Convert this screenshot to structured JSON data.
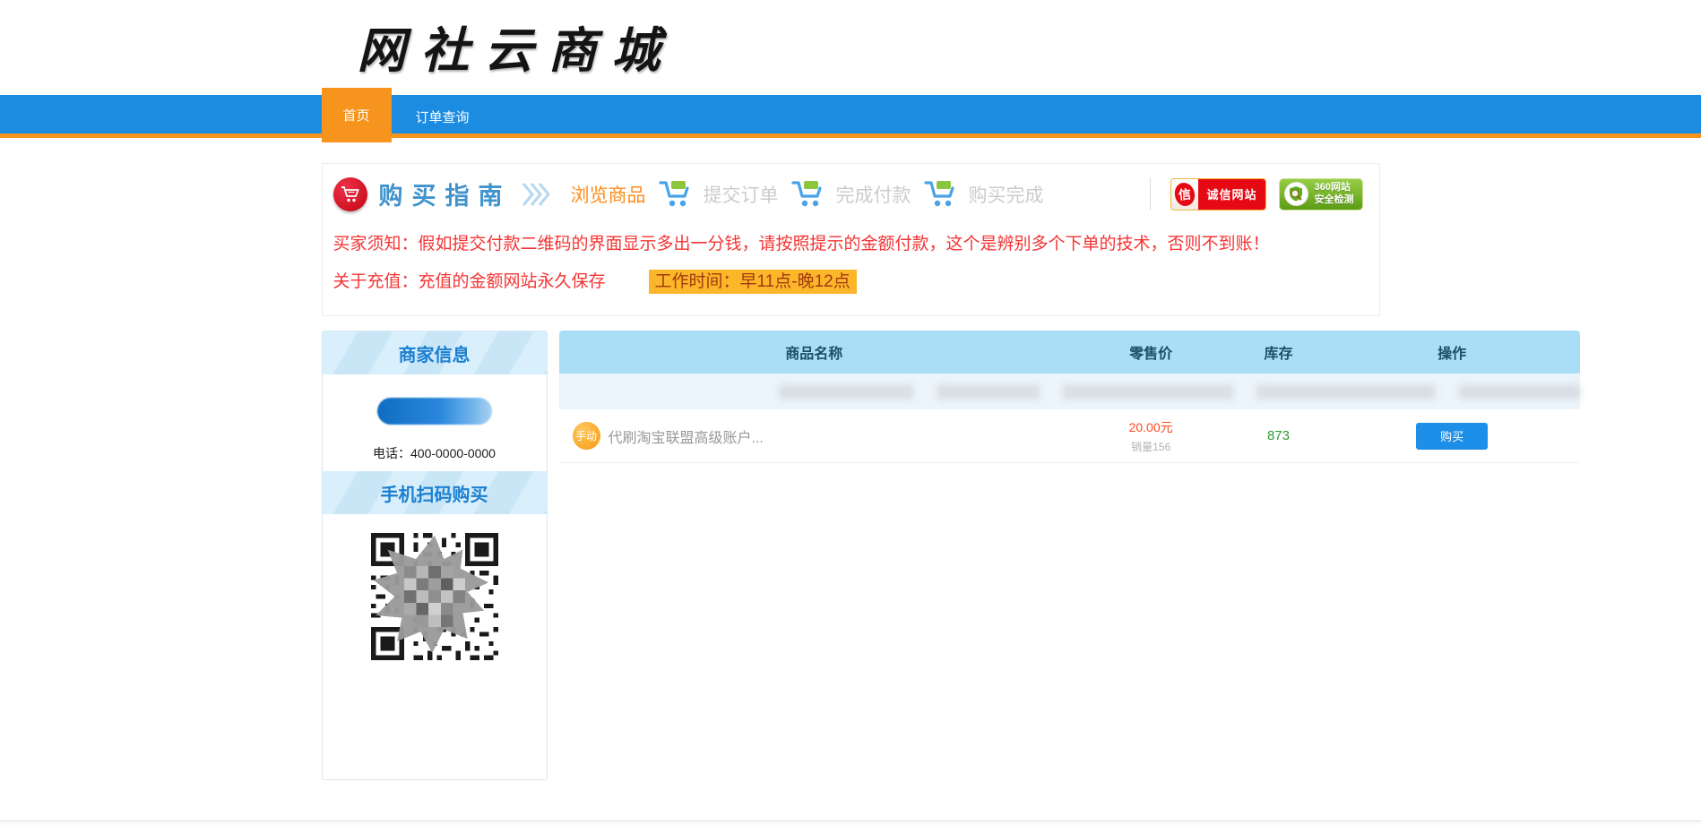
{
  "brand": {
    "logo_text": "网社云商城"
  },
  "nav": {
    "items": [
      {
        "label": "首页",
        "active": true
      },
      {
        "label": "订单查询",
        "active": false
      }
    ]
  },
  "guide": {
    "title": "购买指南",
    "steps": [
      {
        "label": "浏览商品",
        "state": "active"
      },
      {
        "label": "提交订单",
        "state": "inactive"
      },
      {
        "label": "完成付款",
        "state": "inactive"
      },
      {
        "label": "购买完成",
        "state": "inactive"
      }
    ],
    "badges": [
      {
        "label": "诚信网站",
        "glyph": "信"
      },
      {
        "label": "360网站安全检测",
        "line1": "360网站",
        "line2": "安全检测"
      }
    ]
  },
  "notices": {
    "line1": "买家须知：假如提交付款二维码的界面显示多出一分钱，请按照提示的金额付款，这个是辨别多个下单的技术，否则不到账！",
    "line2_prefix": "关于充值：充值的金额网站永久保存",
    "line2_highlight": "工作时间：早11点-晚12点"
  },
  "sidebar": {
    "merchant_title": "商家信息",
    "phone": "电话：400-0000-0000",
    "qr_title": "手机扫码购买"
  },
  "table": {
    "headers": [
      "商品名称",
      "零售价",
      "库存",
      "操作"
    ],
    "rows": [
      {
        "badge": "手动",
        "name": "代刷淘宝联盟高级账户...",
        "price": "20.00元",
        "sales": "销量156",
        "stock": "873",
        "action": "购买"
      }
    ]
  },
  "colors": {
    "nav_blue": "#1b8ce2",
    "accent_orange": "#f7941d",
    "step_active_orange": "#ff8c1a",
    "notice_red": "#f43434",
    "highlight_bg": "#fbb629",
    "table_header_bg": "#aadef7",
    "price_red": "#ff4a21",
    "stock_green": "#2e9a35",
    "buy_button_blue": "#1e8fe8"
  }
}
